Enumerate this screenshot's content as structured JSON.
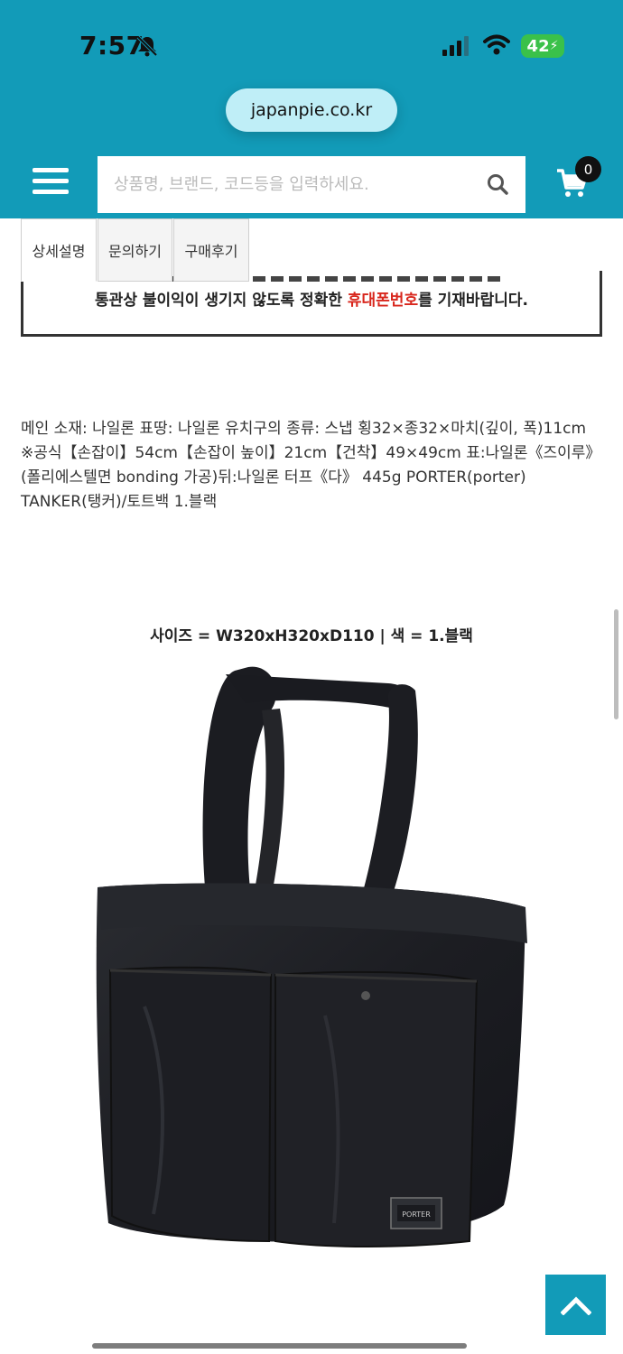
{
  "status_bar": {
    "time": "7:57",
    "battery": "42",
    "icons": [
      "bell-slash-icon",
      "signal-icon",
      "wifi-icon",
      "battery-icon"
    ]
  },
  "browser": {
    "url": "japanpie.co.kr"
  },
  "header": {
    "search_placeholder": "상품명, 브랜드, 코드등을 입력하세요.",
    "cart_count": "0",
    "accent_color": "#129bb8"
  },
  "tabs": [
    {
      "label": "상세설명",
      "active": true
    },
    {
      "label": "문의하기",
      "active": false
    },
    {
      "label": "구매후기",
      "active": false
    }
  ],
  "notice": {
    "prefix": "통관상 불이익이 생기지 않도록 정확한 ",
    "highlight": "휴대폰번호",
    "suffix": "를 기재바랍니다."
  },
  "product": {
    "description": "메인 소재: 나일론 표땅: 나일론 유치구의 종류: 스냅 횡32×종32×마치(깊이, 폭)11cm ※공식【손잡이】54cm【손잡이 높이】21cm【건착】49×49cm 표:나일론《즈이루》(폴리에스텔면 bonding 가공)뒤:나일론 터프《다》 445g PORTER(porter) TANKER(탱커)/토트백 1.블랙",
    "size_line": "사이즈 = W320xH320xD110 | 색 = 1.블랙",
    "label_text": "PORTER"
  }
}
